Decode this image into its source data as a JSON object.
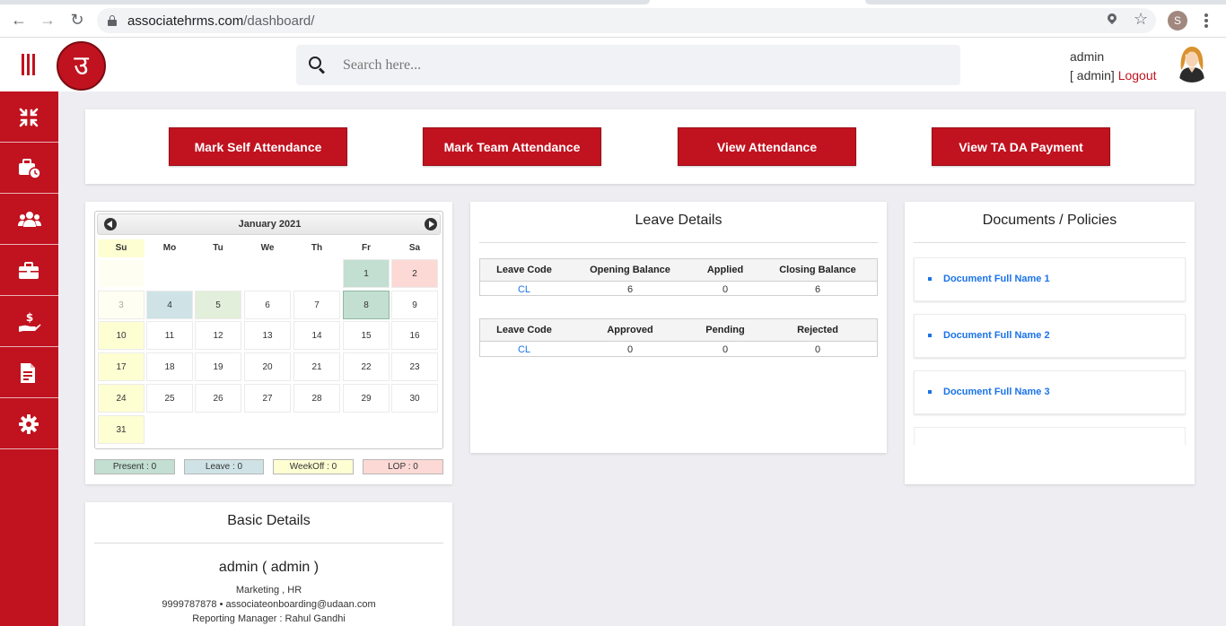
{
  "browser": {
    "url_host": "associatehrms.com",
    "url_path": "/dashboard/",
    "profile_initial": "S"
  },
  "header": {
    "search_placeholder": "Search here...",
    "user_name": "admin",
    "user_role_prefix": "[ admin]",
    "logout_label": "Logout"
  },
  "sidebar": {
    "items": [
      {
        "icon": "compress-arrows-icon"
      },
      {
        "icon": "briefcase-clock-icon"
      },
      {
        "icon": "users-icon"
      },
      {
        "icon": "briefcase-icon"
      },
      {
        "icon": "hand-dollar-icon"
      },
      {
        "icon": "document-icon"
      },
      {
        "icon": "gear-icon"
      }
    ]
  },
  "actions": {
    "mark_self": "Mark Self Attendance",
    "mark_team": "Mark Team Attendance",
    "view_attendance": "View Attendance",
    "view_ta_da": "View TA DA Payment"
  },
  "calendar": {
    "month_label": "January 2021",
    "weekdays": [
      "Su",
      "Mo",
      "Tu",
      "We",
      "Th",
      "Fr",
      "Sa"
    ],
    "leading_blank_days": 5,
    "days_in_month": 31,
    "status": {
      "1": "present",
      "2": "lop",
      "4": "leave",
      "5": "weekoff-green",
      "8": "present-selected",
      "3": "weekoff-faded",
      "10": "weekoff",
      "17": "weekoff",
      "24": "weekoff",
      "31": "weekoff"
    },
    "legend": {
      "present": "Present : 0",
      "leave": "Leave : 0",
      "weekoff": "WeekOff : 0",
      "lop": "LOP : 0"
    }
  },
  "leave_details": {
    "title": "Leave Details",
    "balance_headers": [
      "Leave Code",
      "Opening Balance",
      "Applied",
      "Closing Balance"
    ],
    "balance_row": [
      "CL",
      "6",
      "0",
      "6"
    ],
    "status_headers": [
      "Leave Code",
      "Approved",
      "Pending",
      "Rejected"
    ],
    "status_row": [
      "CL",
      "0",
      "0",
      "0"
    ]
  },
  "documents": {
    "title": "Documents / Policies",
    "items": [
      "Document Full Name 1",
      "Document Full Name 2",
      "Document Full Name 3"
    ]
  },
  "basic_details": {
    "title": "Basic Details",
    "name": "admin ( admin )",
    "department": "Marketing , HR",
    "contact": "9999787878 • associateonboarding@udaan.com",
    "manager": "Reporting Manager : Rahul Gandhi"
  },
  "colors": {
    "brand_red": "#c1121f",
    "present": "#c2dfd1",
    "leave": "#cfe3e6",
    "weekoff": "#fefed3",
    "lop": "#fcd9d5",
    "link_blue": "#1a73e8"
  }
}
